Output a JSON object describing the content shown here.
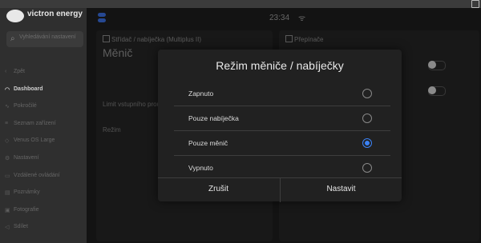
{
  "brand": "victron energy",
  "search": {
    "placeholder": "Vyhledávání nastavení"
  },
  "sidebar": {
    "items": [
      {
        "label": "Zpět",
        "icon": "back-icon"
      },
      {
        "label": "Dashboard",
        "icon": "dashboard-icon",
        "active": true
      },
      {
        "label": "Pokročilé",
        "icon": "advanced-icon"
      },
      {
        "label": "Seznam zařízení",
        "icon": "device-list-icon"
      },
      {
        "label": "Venus OS Large",
        "icon": "venus-icon"
      },
      {
        "label": "Nastavení",
        "icon": "settings-icon"
      },
      {
        "label": "Vzdálené ovládání",
        "icon": "remote-icon"
      },
      {
        "label": "Poznámky",
        "icon": "notes-icon"
      },
      {
        "label": "Fotografie",
        "icon": "photo-icon"
      },
      {
        "label": "Sdílet",
        "icon": "share-icon"
      }
    ]
  },
  "statusbar": {
    "time": "23:34"
  },
  "left_card": {
    "title": "Střídač / nabíječka (Multiplus II)",
    "heading": "Měnič",
    "rows": [
      {
        "label": "Limit vstupního proudu"
      },
      {
        "label": "Režim"
      }
    ]
  },
  "right_card": {
    "title": "Přepínače"
  },
  "dialog": {
    "title": "Režim měniče / nabíječky",
    "options": [
      {
        "label": "Zapnuto",
        "checked": false
      },
      {
        "label": "Pouze nabíječka",
        "checked": false
      },
      {
        "label": "Pouze měnič",
        "checked": true
      },
      {
        "label": "Vypnuto",
        "checked": false
      }
    ],
    "cancel_label": "Zrušit",
    "confirm_label": "Nastavit"
  },
  "colors": {
    "accent": "#3b82f6",
    "background": "#1e1e1e",
    "dialog": "#212121"
  }
}
